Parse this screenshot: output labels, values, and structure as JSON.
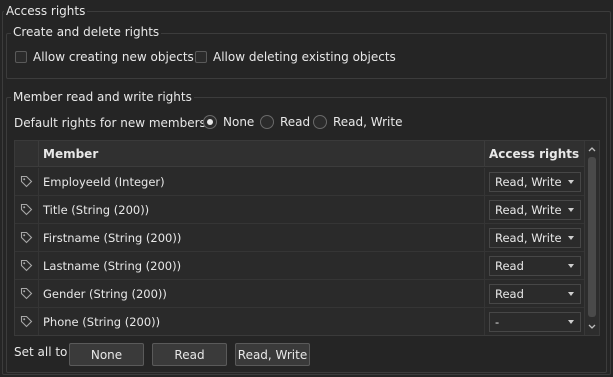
{
  "outer_title": "Access rights",
  "create_delete": {
    "title": "Create and delete rights",
    "allow_create_label": "Allow creating new objects",
    "allow_create_checked": false,
    "allow_delete_label": "Allow deleting existing objects",
    "allow_delete_checked": false
  },
  "member_rights": {
    "title": "Member read and write rights",
    "default_label": "Default rights for new members",
    "options": [
      "None",
      "Read",
      "Read, Write"
    ],
    "selected": "None"
  },
  "table": {
    "columns": {
      "member": "Member",
      "access": "Access rights"
    },
    "rows": [
      {
        "icon": "tag-icon",
        "member": "EmployeeId (Integer)",
        "access": "Read, Write"
      },
      {
        "icon": "tag-icon",
        "member": "Title (String (200))",
        "access": "Read, Write"
      },
      {
        "icon": "tag-icon",
        "member": "Firstname (String (200))",
        "access": "Read, Write"
      },
      {
        "icon": "tag-icon",
        "member": "Lastname (String (200))",
        "access": "Read"
      },
      {
        "icon": "tag-icon",
        "member": "Gender (String (200))",
        "access": "Read"
      },
      {
        "icon": "tag-icon",
        "member": "Phone (String (200))",
        "access": "-"
      }
    ]
  },
  "set_all": {
    "label": "Set all to",
    "none": "None",
    "read": "Read",
    "read_write": "Read, Write"
  }
}
